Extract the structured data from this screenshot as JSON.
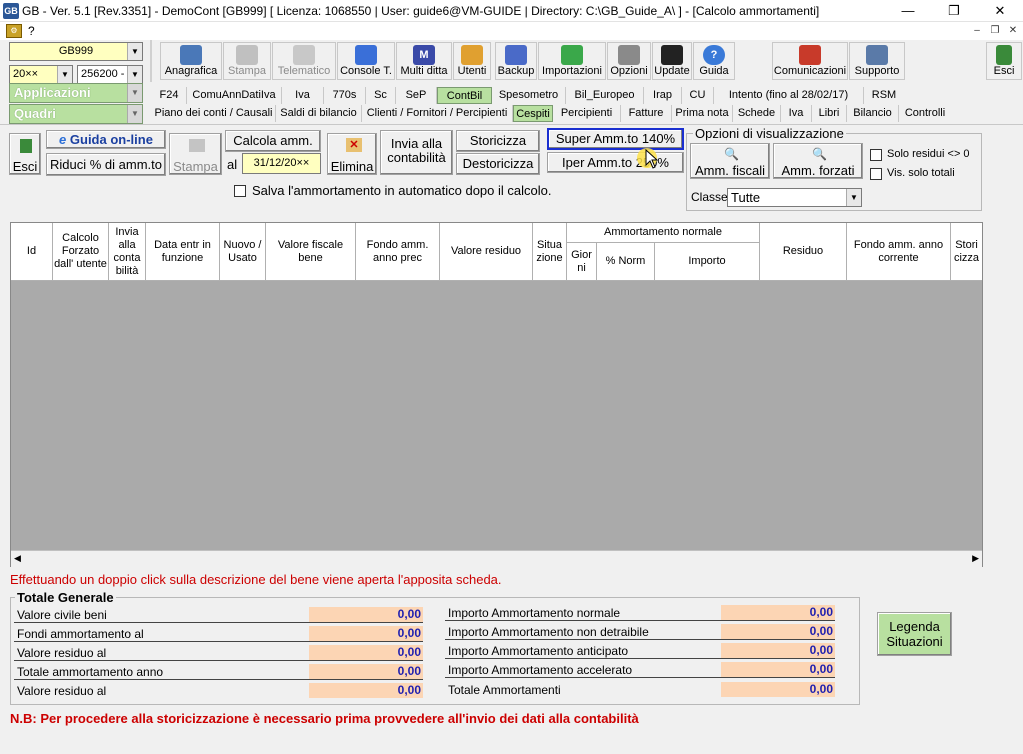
{
  "window": {
    "title": "GB - Ver. 5.1 [Rev.3351] -  DemoCont [GB999]     [ Licenza: 1068550 | User: guide6@VM-GUIDE | Directory: C:\\GB_Guide_A\\ ] - [Calcolo ammortamenti]",
    "logo": "GB",
    "minimize": "—",
    "restore": "❐",
    "close": "✕",
    "menu_help": "?"
  },
  "selectors": {
    "company": "GB999",
    "year": "20××",
    "account": "256200 -",
    "applicazioni": "Applicazioni",
    "quadri": "Quadri"
  },
  "toolbar": [
    {
      "name": "anagrafica",
      "label": "Anagrafica",
      "enabled": true
    },
    {
      "name": "stampa",
      "label": "Stampa",
      "enabled": false
    },
    {
      "name": "telematico",
      "label": "Telematico",
      "enabled": false
    },
    {
      "name": "console",
      "label": "Console T.",
      "enabled": true
    },
    {
      "name": "multi-ditta",
      "label": "Multi ditta",
      "enabled": true
    },
    {
      "name": "utenti",
      "label": "Utenti",
      "enabled": true
    },
    {
      "name": "backup",
      "label": "Backup",
      "enabled": true
    },
    {
      "name": "importazioni",
      "label": "Importazioni",
      "enabled": true
    },
    {
      "name": "opzioni",
      "label": "Opzioni",
      "enabled": true
    },
    {
      "name": "update",
      "label": "Update",
      "enabled": true
    },
    {
      "name": "guida",
      "label": "Guida",
      "enabled": true
    },
    {
      "name": "comunicazioni",
      "label": "Comunicazioni",
      "enabled": true
    },
    {
      "name": "supporto",
      "label": "Supporto",
      "enabled": true
    },
    {
      "name": "esci",
      "label": "Esci",
      "enabled": true
    }
  ],
  "tabs_row1": [
    "F24",
    "ComuAnnDatiIva",
    "Iva",
    "770s",
    "Sc",
    "SeP",
    "ContBil",
    "Spesometro",
    "Bil_Europeo",
    "Irap",
    "CU",
    "Intento (fino al 28/02/17)",
    "RSM"
  ],
  "tabs_row1_active": "ContBil",
  "tabs_row2": [
    "Piano dei conti / Causali",
    "Saldi di bilancio",
    "Clienti / Fornitori / Percipienti",
    "Cespiti",
    "Percipienti",
    "Fatture",
    "Prima nota",
    "Schede",
    "Iva",
    "Libri",
    "Bilancio",
    "Controlli"
  ],
  "tabs_row2_active": "Cespiti",
  "actions": {
    "esci": "Esci",
    "guida_online": "Guida on-line",
    "riduci": "Riduci % di amm.to",
    "stampa": "Stampa",
    "calcola": "Calcola amm.",
    "al_label": "al",
    "date": "31/12/20××",
    "elimina": "Elimina",
    "invia": "Invia alla contabilità",
    "storicizza": "Storicizza",
    "destoricizza": "Destoricizza",
    "super": "Super Amm.to 140%",
    "iper": "Iper Amm.to 250%",
    "salva_auto": "Salva l'ammortamento in automatico dopo il calcolo."
  },
  "options": {
    "title": "Opzioni di visualizzazione",
    "amm_fiscali": "Amm. fiscali",
    "amm_forzati": "Amm. forzati",
    "solo_residui": "Solo residui <> 0",
    "solo_totali": "Vis. solo totali",
    "classe_label": "Classe",
    "classe_value": "Tutte"
  },
  "grid": {
    "group_header": "Ammortamento normale",
    "columns": [
      "Id",
      "Calcolo Forzato dall' utente",
      "Invia alla conta bilità",
      "Data entr in funzione",
      "Nuovo / Usato",
      "Valore fiscale bene",
      "Fondo amm. anno prec",
      "Valore residuo",
      "Situa zione",
      "Gior ni",
      "% Norm",
      "Importo",
      "Residuo",
      "Fondo amm. anno corrente",
      "Stori cizza"
    ]
  },
  "hint": "Effettuando un doppio click sulla descrizione del bene viene aperta l'apposita scheda.",
  "totals": {
    "title": "Totale Generale",
    "left": [
      {
        "label": "Valore civile beni",
        "value": "0,00"
      },
      {
        "label": "Fondi ammortamento al",
        "value": "0,00"
      },
      {
        "label": "Valore residuo al",
        "value": "0,00"
      },
      {
        "label": "Totale ammortamento anno",
        "value": "0,00"
      },
      {
        "label": "Valore residuo al",
        "value": "0,00"
      }
    ],
    "right": [
      {
        "label": "Importo Ammortamento normale",
        "value": "0,00"
      },
      {
        "label": "Importo Ammortamento non detraibile",
        "value": "0,00"
      },
      {
        "label": "Importo Ammortamento anticipato",
        "value": "0,00"
      },
      {
        "label": "Importo Ammortamento accelerato",
        "value": "0,00"
      },
      {
        "label": "Totale Ammortamenti",
        "value": "0,00"
      }
    ]
  },
  "legenda": "Legenda Situazioni",
  "note": "N.B: Per procedere alla storicizzazione è necessario prima provvedere all'invio dei dati alla contabilità",
  "colors": {
    "green_active": "#b8e0a0",
    "highlight_border": "#1a2fd0",
    "value_bg": "#fcd5b4",
    "value_fg": "#1f1fb0",
    "hint_red": "#cc0000"
  }
}
